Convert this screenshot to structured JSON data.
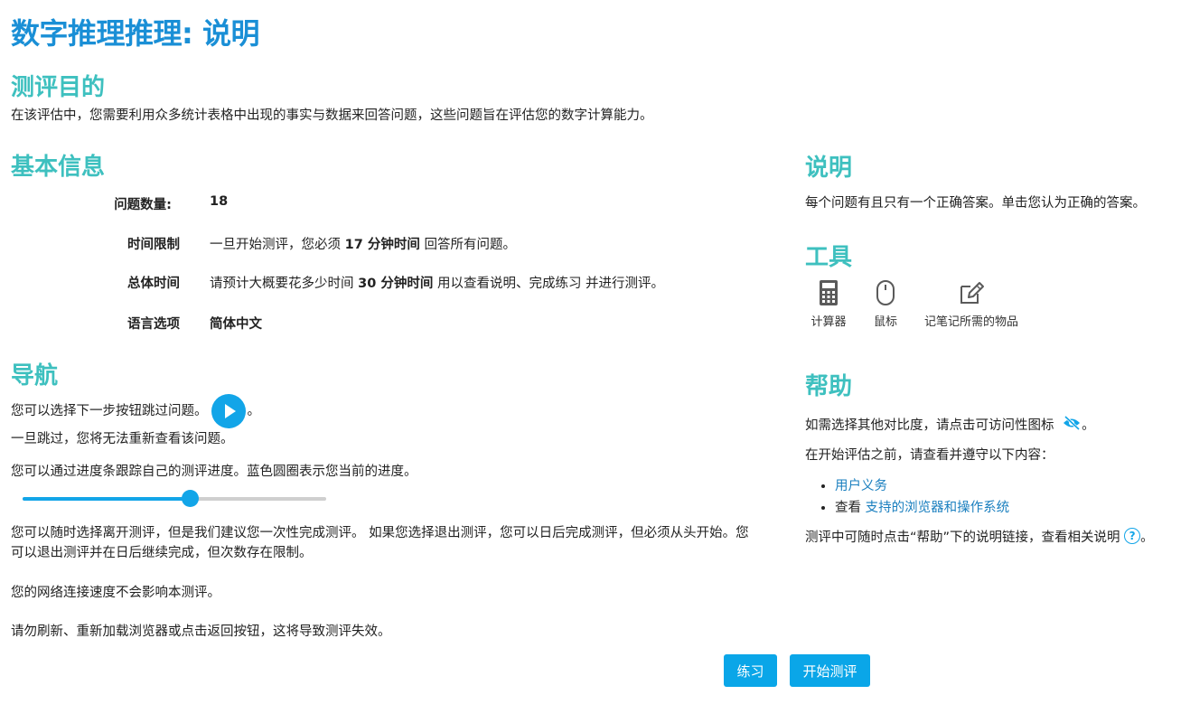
{
  "page": {
    "title": "数字推理推理: 说明"
  },
  "purpose": {
    "title": "测评目的",
    "text": "在该评估中，您需要利用众多统计表格中出现的事实与数据来回答问题，这些问题旨在评估您的数字计算能力。"
  },
  "basic_info": {
    "title": "基本信息",
    "rows": [
      {
        "label": "问题数量:",
        "value_pre": "18",
        "value_bold": "",
        "value_post": ""
      },
      {
        "label": "时间限制",
        "value_pre": "一旦开始测评，您必须 ",
        "value_bold": "17 分钟时间",
        "value_post": " 回答所有问题。"
      },
      {
        "label": "总体时间",
        "value_pre": "请预计大概要花多少时间 ",
        "value_bold": "30 分钟时间",
        "value_post": " 用以查看说明、完成练习 并进行测评。"
      },
      {
        "label": "语言选项",
        "value_pre": "",
        "value_bold": "简体中文",
        "value_post": ""
      }
    ]
  },
  "navigation": {
    "title": "导航",
    "skip_text": "您可以选择下一步按钮跳过问题。",
    "skip_suffix": "。",
    "no_review": "一旦跳过，您将无法重新查看该问题。",
    "progress_text": "您可以通过进度条跟踪自己的测评进度。蓝色圆圈表示您当前的进度。",
    "progress_fraction": 0.55,
    "leave_text": "您可以随时选择离开测评，但是我们建议您一次性完成测评。 如果您选择退出测评，您可以日后完成测评，但必须从头开始。您可以退出测评并在日后继续完成，但次数存在限制。",
    "network_text": "您的网络连接速度不会影响本测评。",
    "refresh_text": "请勿刷新、重新加载浏览器或点击返回按钮，这将导致测评失效。"
  },
  "instructions": {
    "title": "说明",
    "text": "每个问题有且只有一个正确答案。单击您认为正确的答案。"
  },
  "tools": {
    "title": "工具",
    "items": [
      {
        "label": "计算器",
        "icon": "calculator-icon"
      },
      {
        "label": "鼠标",
        "icon": "mouse-icon"
      },
      {
        "label": "记笔记所需的物品",
        "icon": "note-edit-icon"
      }
    ]
  },
  "help": {
    "title": "帮助",
    "contrast_text": "如需选择其他对比度，请点击可访问性图标",
    "contrast_suffix": "。",
    "before_text": "在开始评估之前，请查看并遵守以下内容：",
    "list": [
      {
        "prefix": "",
        "link": "用户义务"
      },
      {
        "prefix": "查看 ",
        "link": "支持的浏览器和操作系统"
      }
    ],
    "help_text": "测评中可随时点击“帮助”下的说明链接，查看相关说明",
    "help_suffix": "。",
    "help_icon_glyph": "?"
  },
  "actions": {
    "practice": "练习",
    "start": "开始测评"
  },
  "colors": {
    "title": "#1a8fd6",
    "section": "#3ec0bf",
    "accent": "#12a5e8",
    "link": "#1a7fbf"
  }
}
